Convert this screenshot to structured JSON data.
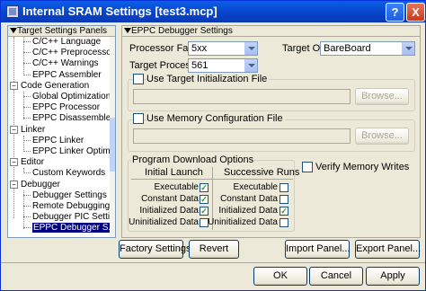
{
  "window": {
    "title": "Internal SRAM Settings [test3.mcp]"
  },
  "titlebar": {
    "help_label": "?",
    "close_label": "X"
  },
  "left_panel": {
    "header": "Target Settings Panels",
    "items": [
      {
        "label": "C/C++ Language",
        "type": "leaf"
      },
      {
        "label": "C/C++ Preprocessor",
        "type": "leaf"
      },
      {
        "label": "C/C++ Warnings",
        "type": "leaf"
      },
      {
        "label": "EPPC Assembler",
        "type": "leaf"
      },
      {
        "label": "Code Generation",
        "type": "group"
      },
      {
        "label": "Global Optimizations",
        "type": "leaf"
      },
      {
        "label": "EPPC Processor",
        "type": "leaf"
      },
      {
        "label": "EPPC Disassembler",
        "type": "leaf"
      },
      {
        "label": "Linker",
        "type": "group"
      },
      {
        "label": "EPPC Linker",
        "type": "leaf"
      },
      {
        "label": "EPPC Linker Optimi...",
        "type": "leaf"
      },
      {
        "label": "Editor",
        "type": "group"
      },
      {
        "label": "Custom Keywords",
        "type": "leaf"
      },
      {
        "label": "Debugger",
        "type": "group"
      },
      {
        "label": "Debugger Settings",
        "type": "leaf"
      },
      {
        "label": "Remote Debugging",
        "type": "leaf"
      },
      {
        "label": "Debugger PIC Setti...",
        "type": "leaf"
      },
      {
        "label": "EPPC Debugger S...",
        "type": "leaf",
        "selected": true
      }
    ]
  },
  "right_panel": {
    "header": "EPPC Debugger Settings",
    "processor_family": {
      "label": "Processor Family:",
      "value": "5xx"
    },
    "target_os": {
      "label": "Target OS:",
      "value": "BareBoard"
    },
    "target_processor": {
      "label": "Target Processor:",
      "value": "561"
    },
    "use_target_init": {
      "label": "Use Target Initialization File",
      "checked": false,
      "browse": "Browse..."
    },
    "use_mem_config": {
      "label": "Use Memory Configuration File",
      "checked": false,
      "browse": "Browse..."
    },
    "download": {
      "title": "Program Download Options",
      "initial_launch": "Initial Launch",
      "successive_runs": "Successive Runs",
      "rows": [
        {
          "label": "Executable",
          "initial": true,
          "successive": false
        },
        {
          "label": "Constant Data",
          "initial": true,
          "successive": false
        },
        {
          "label": "Initialized Data",
          "initial": true,
          "successive": true
        },
        {
          "label": "Uninitialized Data",
          "initial": false,
          "successive": false
        }
      ]
    },
    "verify_memory_writes": {
      "label": "Verify Memory Writes",
      "checked": false
    }
  },
  "buttons": {
    "factory_settings": "Factory Settings",
    "revert": "Revert",
    "import_panel": "Import Panel...",
    "export_panel": "Export Panel...",
    "ok": "OK",
    "cancel": "Cancel",
    "apply": "Apply"
  },
  "check_mark": "✓"
}
